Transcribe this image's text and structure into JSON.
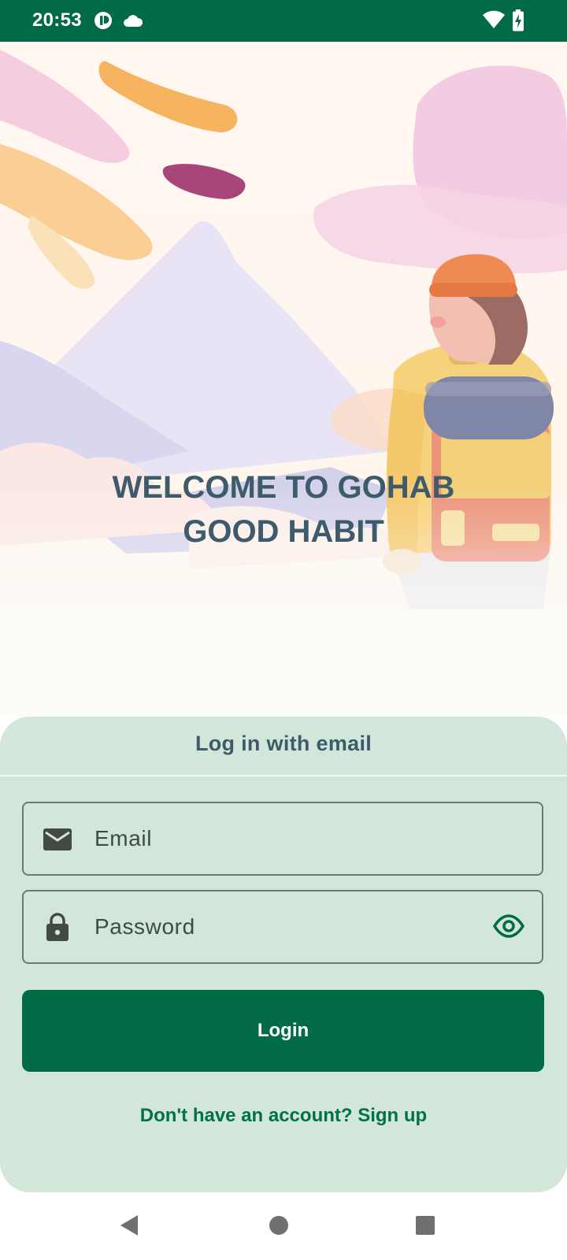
{
  "status_bar": {
    "time": "20:53",
    "icons": [
      "app-notification-icon",
      "cloud-icon",
      "wifi-icon",
      "battery-charging-icon"
    ]
  },
  "hero": {
    "title_line1": "WELCOME TO GOHAB",
    "title_line2": "GOOD HABIT"
  },
  "login_sheet": {
    "title": "Log in with email",
    "email_placeholder": "Email",
    "password_placeholder": "Password",
    "login_label": "Login",
    "signup_link": "Don't have an account? Sign up"
  },
  "colors": {
    "primary": "#006b45",
    "sheet_background": "#d2e7d9",
    "heading_text": "#3d5b6b",
    "link_text": "#00714a"
  },
  "nav_bar": {
    "buttons": [
      "back-icon",
      "home-icon",
      "recents-icon"
    ]
  }
}
